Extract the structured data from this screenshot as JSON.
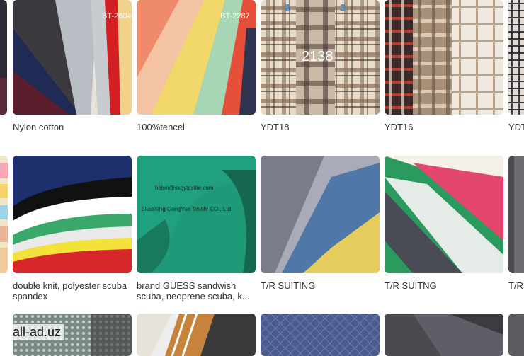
{
  "products": [
    {
      "title": "Nylon cotton",
      "tag": "BT-2604"
    },
    {
      "title": "100%tencel",
      "tag": "BT-2287"
    },
    {
      "title": "YDT18",
      "overlay_number": "2138",
      "tab_numbers": [
        "2",
        "3"
      ]
    },
    {
      "title": "YDT16"
    },
    {
      "title": "YDT"
    },
    {
      "title": "double knit, polyester scuba spandex"
    },
    {
      "title": "brand GUESS sandwish scuba, neoprene scuba, k..."
    },
    {
      "title": "T/R SUITING"
    },
    {
      "title": "T/R SUITNG"
    },
    {
      "title": "T/R"
    },
    {
      "title": ""
    },
    {
      "title": ""
    },
    {
      "title": ""
    },
    {
      "title": ""
    }
  ],
  "card2_fabric_text": {
    "email": "helen@sxgytextile.com",
    "company": "ShaoXing GongYue Textile CO., Ltd"
  },
  "watermark": "all-ad.uz"
}
